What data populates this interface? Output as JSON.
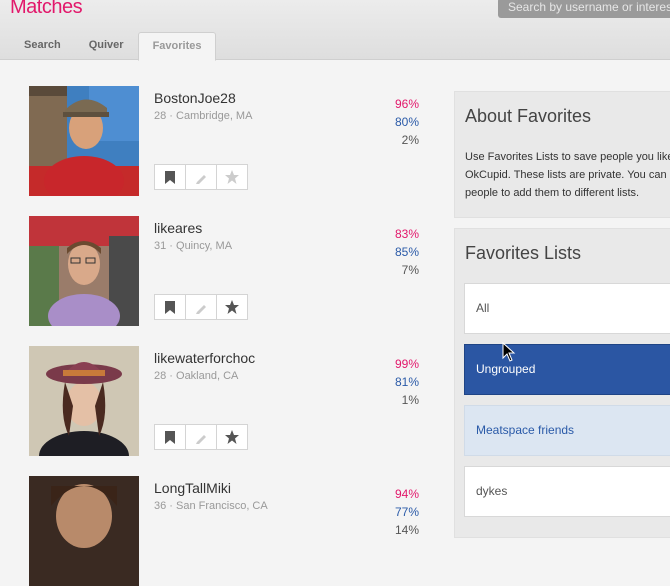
{
  "header": {
    "title": "Matches",
    "search_placeholder": "Search by username or interests"
  },
  "tabs": [
    {
      "label": "Search"
    },
    {
      "label": "Quiver"
    },
    {
      "label": "Favorites",
      "active": true
    }
  ],
  "matches": [
    {
      "username": "BostonJoe28",
      "meta": "28 · Cambridge, MA",
      "match": "96%",
      "friend": "80%",
      "enemy": "2%"
    },
    {
      "username": "likeares",
      "meta": "31 · Quincy, MA",
      "match": "83%",
      "friend": "85%",
      "enemy": "7%"
    },
    {
      "username": "likewaterforchoc",
      "meta": "28 · Oakland, CA",
      "match": "99%",
      "friend": "81%",
      "enemy": "1%"
    },
    {
      "username": "LongTallMiki",
      "meta": "36 · San Francisco, CA",
      "match": "94%",
      "friend": "77%",
      "enemy": "14%"
    }
  ],
  "about": {
    "title": "About Favorites",
    "text": "Use Favorites Lists to save people you like on OkCupid. These lists are private. You can drag people to add them to different lists."
  },
  "favorites_lists": {
    "title": "Favorites Lists",
    "items": [
      {
        "label": "All"
      },
      {
        "label": "Ungrouped",
        "selected": true
      },
      {
        "label": "Meatspace friends"
      },
      {
        "label": "dykes"
      }
    ]
  },
  "colors": {
    "brand": "#e2186b",
    "match": "#e2186b",
    "friend": "#2a5aa8",
    "selected": "#2b56a3"
  }
}
